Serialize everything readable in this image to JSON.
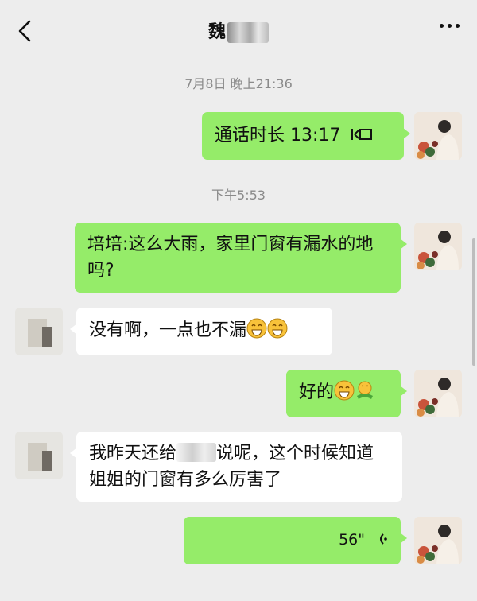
{
  "header": {
    "title": "魏",
    "back_icon": "chevron-left-icon",
    "more_icon": "more-horizontal-icon"
  },
  "timestamps": [
    "7月8日 晚上21:36",
    "下午5:53"
  ],
  "messages": [
    {
      "sender": "me",
      "type": "call",
      "text": "通话时长 13:17",
      "icon": "video-call-icon"
    },
    {
      "sender": "me",
      "type": "text",
      "text": "培培:这么大雨，家里门窗有漏水的地吗?"
    },
    {
      "sender": "other",
      "type": "text",
      "text": "没有啊，一点也不漏",
      "emojis": [
        "grin-emoji",
        "grin-emoji"
      ]
    },
    {
      "sender": "me",
      "type": "text",
      "text": "好的",
      "emojis": [
        "grin-emoji",
        "hug-emoji"
      ]
    },
    {
      "sender": "other",
      "type": "text",
      "text_before": "我昨天还给",
      "text_after": "说呢，这个时候知道姐姐的门窗有多么厉害了"
    },
    {
      "sender": "me",
      "type": "voice",
      "duration": "56\"",
      "icon": "voice-wave-icon"
    }
  ]
}
